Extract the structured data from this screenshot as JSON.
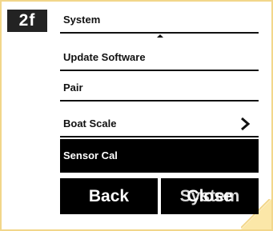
{
  "step": {
    "label": "2f"
  },
  "menu": {
    "items": [
      {
        "label": "System"
      },
      {
        "label": "Update Software"
      },
      {
        "label": "Pair"
      },
      {
        "label": "Boat Scale"
      },
      {
        "label": "Sensor Cal"
      }
    ],
    "selected_index": 4
  },
  "softkeys": {
    "left_label": "Back",
    "right_label_a": "Close",
    "right_label_b": "System"
  },
  "colors": {
    "frame": "#f2d68a",
    "badge": "#232323",
    "selection": "#000000",
    "text": "#111111"
  },
  "icons": {
    "scroll_up": "triangle-up-icon",
    "scroll_down": "triangle-down-icon",
    "submenu": "chevron-right-icon"
  }
}
